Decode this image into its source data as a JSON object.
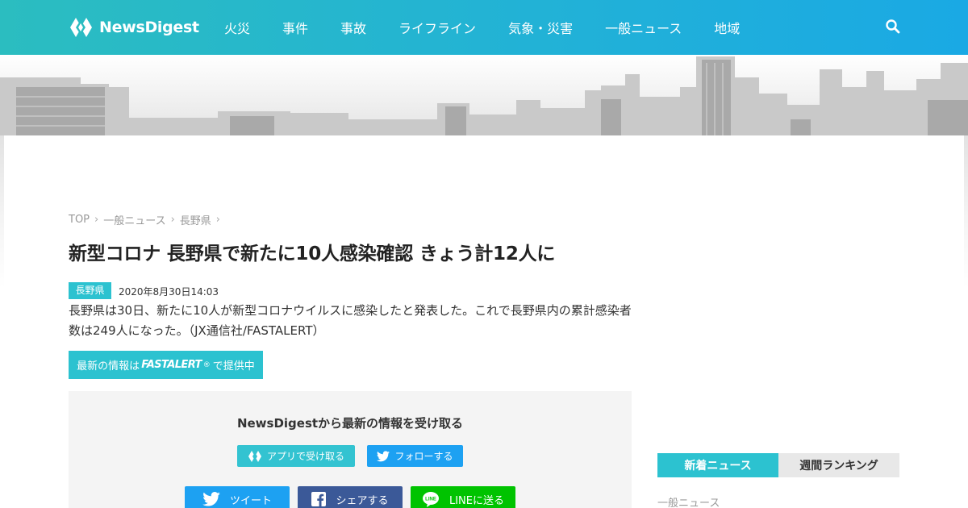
{
  "site": {
    "name": "NewsDigest"
  },
  "nav": {
    "items": [
      "火災",
      "事件",
      "事故",
      "ライフライン",
      "気象・災害",
      "一般ニュース",
      "地域"
    ]
  },
  "breadcrumb": {
    "items": [
      "TOP",
      "一般ニュース",
      "長野県"
    ],
    "separator": "›"
  },
  "article": {
    "title": "新型コロナ 長野県で新たに10人感染確認 きょう計12人に",
    "tag": "長野県",
    "date": "2020年8月30日14:03",
    "body": "長野県は30日、新たに10人が新型コロナウイルスに感染したと発表した。これで長野県内の累計感染者数は249人になった。（JX通信社/FASTALERT）"
  },
  "fastalert": {
    "prefix": "最新の情報は",
    "brand": "FASTALERT",
    "suffix": "で提供中"
  },
  "follow": {
    "title": "NewsDigestから最新の情報を受け取る",
    "app_label": "アプリで受け取る",
    "twitter_follow_label": "フォローする"
  },
  "share": {
    "tweet_label": "ツイート",
    "facebook_label": "シェアする",
    "line_label": "LINEに送る"
  },
  "sidebar": {
    "tabs": [
      "新着ニュース",
      "週間ランキング"
    ],
    "active_tab": "新着ニュース",
    "first_category": "一般ニュース"
  },
  "colors": {
    "header_start": "#2bbdc0",
    "header_end": "#1aa9e4",
    "accent": "#2cc2d0",
    "twitter": "#1da1f2",
    "facebook": "#3b5998",
    "line": "#00c300"
  },
  "icons": {
    "logo": "newsdigest-logo-icon",
    "search": "search-icon",
    "twitter": "twitter-bird-icon",
    "facebook": "facebook-f-icon",
    "line": "line-icon"
  }
}
